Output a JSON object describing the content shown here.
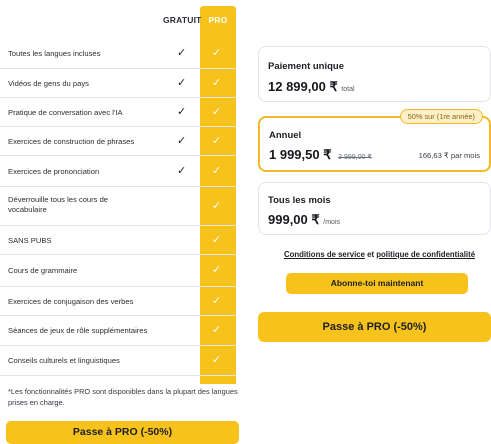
{
  "comparison": {
    "headers": {
      "free": "GRATUIT",
      "pro": "PRO"
    },
    "features": [
      {
        "label": "Toutes les langues incluses",
        "free": true,
        "pro": true
      },
      {
        "label": "Vidéos de gens du pays",
        "free": true,
        "pro": true
      },
      {
        "label": "Pratique de conversation avec l'IA",
        "free": true,
        "pro": true
      },
      {
        "label": "Exercices de construction de phrases",
        "free": true,
        "pro": true
      },
      {
        "label": "Exercices de prononciation",
        "free": true,
        "pro": true
      },
      {
        "label": "Déverrouille tous les cours de vocabulaire",
        "free": false,
        "pro": true
      },
      {
        "label": "SANS PUBS",
        "free": false,
        "pro": true
      },
      {
        "label": "Cours de grammaire",
        "free": false,
        "pro": true
      },
      {
        "label": "Exercices de conjugaison des verbes",
        "free": false,
        "pro": true
      },
      {
        "label": "Séances de jeux de rôle supplémentaires",
        "free": false,
        "pro": true
      },
      {
        "label": "Conseils culturels et linguistiques",
        "free": false,
        "pro": true
      }
    ],
    "checkmark": "✓",
    "footnote": "*Les fonctionnalités PRO sont disponibles dans la plupart des langues prises en charge.",
    "cta": "Passe à PRO (-50%)"
  },
  "plans": {
    "one_time": {
      "title": "Paiement unique",
      "price": "12 899,00 ₹",
      "unit": "total"
    },
    "annual": {
      "badge": "50% sur (1re année)",
      "title": "Annuel",
      "price": "1 999,50 ₹",
      "old_price": "3 999,00 ₹",
      "per_month": "166,63 ₹ par mois",
      "selected": true
    },
    "monthly": {
      "title": "Tous les mois",
      "price": "999,00 ₹",
      "unit": "/mois"
    }
  },
  "terms": {
    "link1": "Conditions de service",
    "conj": "et",
    "link2": "politique de confidentialité"
  },
  "subscribe_label": "Abonne-toi maintenant",
  "cta_right": "Passe à PRO (-50%)",
  "colors": {
    "accent": "#f7c21c",
    "selected_border": "#f4b92a"
  }
}
